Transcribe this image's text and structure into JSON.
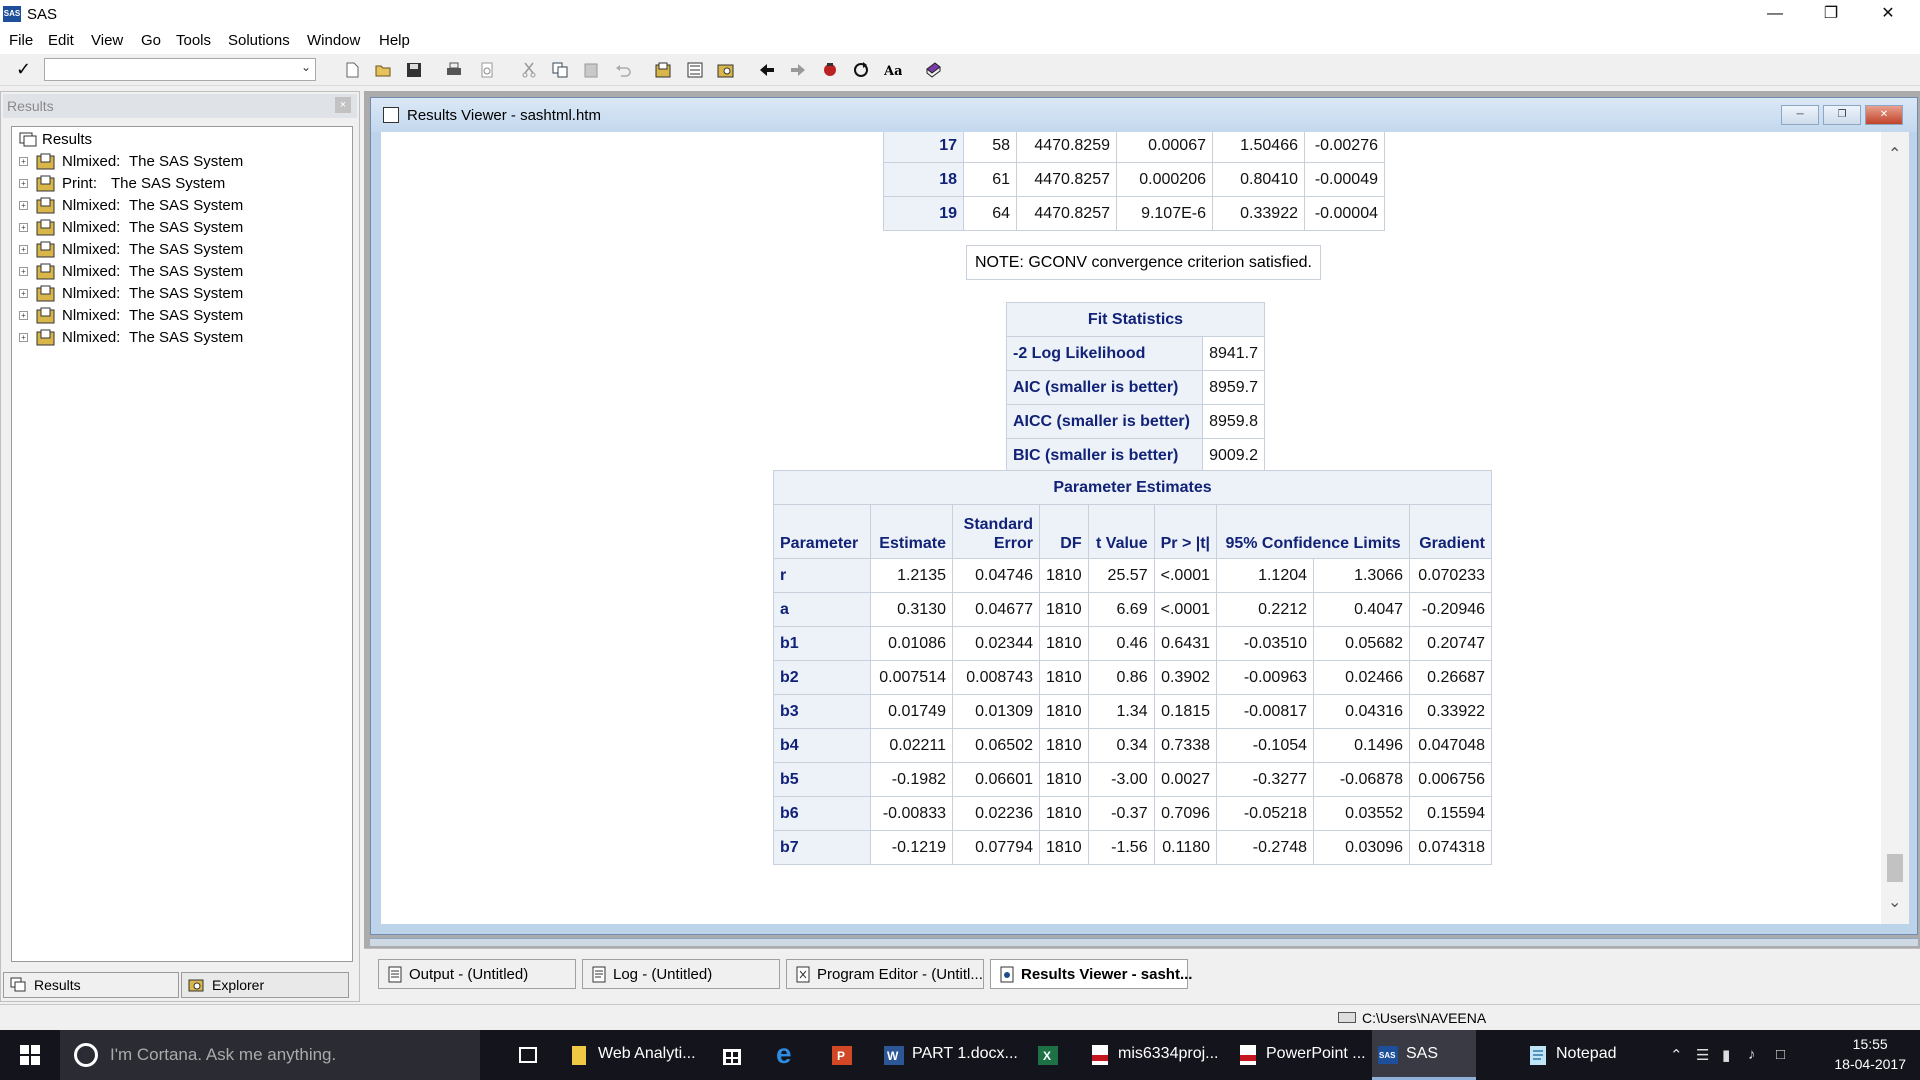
{
  "window": {
    "title": "SAS",
    "minimize": "—",
    "restore": "❐",
    "close": "✕"
  },
  "menu": [
    "File",
    "Edit",
    "View",
    "Go",
    "Tools",
    "Solutions",
    "Window",
    "Help"
  ],
  "toolbar": {
    "command_value": "",
    "check": "✓"
  },
  "results_pane": {
    "title": "Results",
    "close": "×",
    "root": "Results",
    "items": [
      {
        "kind": "Nlmixed:",
        "label": "The SAS System"
      },
      {
        "kind": "Print:",
        "label": "The SAS System"
      },
      {
        "kind": "Nlmixed:",
        "label": "The SAS System"
      },
      {
        "kind": "Nlmixed:",
        "label": "The SAS System"
      },
      {
        "kind": "Nlmixed:",
        "label": "The SAS System"
      },
      {
        "kind": "Nlmixed:",
        "label": "The SAS System"
      },
      {
        "kind": "Nlmixed:",
        "label": "The SAS System"
      },
      {
        "kind": "Nlmixed:",
        "label": "The SAS System"
      },
      {
        "kind": "Nlmixed:",
        "label": "The SAS System"
      }
    ],
    "tabs": [
      "Results",
      "Explorer"
    ]
  },
  "viewer": {
    "title": "Results Viewer - sashtml.htm",
    "iterations": [
      [
        "17",
        "58",
        "4470.8259",
        "0.00067",
        "1.50466",
        "-0.00276"
      ],
      [
        "18",
        "61",
        "4470.8257",
        "0.000206",
        "0.80410",
        "-0.00049"
      ],
      [
        "19",
        "64",
        "4470.8257",
        "9.107E-6",
        "0.33922",
        "-0.00004"
      ]
    ],
    "note": "NOTE: GCONV convergence criterion satisfied.",
    "fit": {
      "title": "Fit Statistics",
      "rows": [
        [
          "-2 Log Likelihood",
          "8941.7"
        ],
        [
          "AIC (smaller is better)",
          "8959.7"
        ],
        [
          "AICC (smaller is better)",
          "8959.8"
        ],
        [
          "BIC (smaller is better)",
          "9009.2"
        ]
      ]
    },
    "params": {
      "title": "Parameter Estimates",
      "headers": [
        "Parameter",
        "Estimate",
        "Standard Error",
        "DF",
        "t Value",
        "Pr > |t|",
        "95% Confidence Limits",
        "Gradient"
      ],
      "rows": [
        [
          "r",
          "1.2135",
          "0.04746",
          "1810",
          "25.57",
          "<.0001",
          "1.1204",
          "1.3066",
          "0.070233"
        ],
        [
          "a",
          "0.3130",
          "0.04677",
          "1810",
          "6.69",
          "<.0001",
          "0.2212",
          "0.4047",
          "-0.20946"
        ],
        [
          "b1",
          "0.01086",
          "0.02344",
          "1810",
          "0.46",
          "0.6431",
          "-0.03510",
          "0.05682",
          "0.20747"
        ],
        [
          "b2",
          "0.007514",
          "0.008743",
          "1810",
          "0.86",
          "0.3902",
          "-0.00963",
          "0.02466",
          "0.26687"
        ],
        [
          "b3",
          "0.01749",
          "0.01309",
          "1810",
          "1.34",
          "0.1815",
          "-0.00817",
          "0.04316",
          "0.33922"
        ],
        [
          "b4",
          "0.02211",
          "0.06502",
          "1810",
          "0.34",
          "0.7338",
          "-0.1054",
          "0.1496",
          "0.047048"
        ],
        [
          "b5",
          "-0.1982",
          "0.06601",
          "1810",
          "-3.00",
          "0.0027",
          "-0.3277",
          "-0.06878",
          "0.006756"
        ],
        [
          "b6",
          "-0.00833",
          "0.02236",
          "1810",
          "-0.37",
          "0.7096",
          "-0.05218",
          "0.03552",
          "0.15594"
        ],
        [
          "b7",
          "-0.1219",
          "0.07794",
          "1810",
          "-1.56",
          "0.1180",
          "-0.2748",
          "0.03096",
          "0.074318"
        ]
      ]
    }
  },
  "window_tabs": [
    "Output - (Untitled)",
    "Log - (Untitled)",
    "Program Editor - (Untitl...",
    "Results Viewer - sasht..."
  ],
  "status": {
    "path": "C:\\Users\\NAVEENA"
  },
  "taskbar": {
    "cortana": "I'm Cortana. Ask me anything.",
    "apps": [
      "Web Analyti...",
      "PART 1.docx...",
      "mis6334proj...",
      "PowerPoint ...",
      "SAS",
      "Notepad"
    ],
    "time": "15:55",
    "date": "18-04-2017"
  },
  "colors": {
    "header_text": "#112277",
    "header_bg": "#edf2f9",
    "taskbar": "#14141c"
  }
}
